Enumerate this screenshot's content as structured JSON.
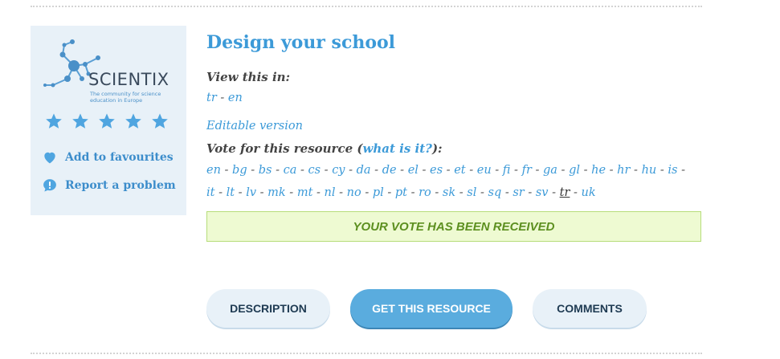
{
  "sidebar": {
    "logo": {
      "word": "SCIENTIX",
      "subtitle": "The community for science education in Europe"
    },
    "rating": {
      "stars": 5,
      "max": 5
    },
    "favourites_label": "Add to favourites",
    "report_label": "Report a problem"
  },
  "resource": {
    "title": "Design your school",
    "view_label": "View this in:",
    "view_languages": [
      "tr",
      "en"
    ],
    "editable_label": "Editable version",
    "vote_label_prefix": "Vote for this resource (",
    "vote_label_link": "what is it?",
    "vote_label_suffix": "):",
    "vote_languages_line1": [
      "en",
      "bg",
      "bs",
      "ca",
      "cs",
      "cy",
      "da",
      "de",
      "el",
      "es",
      "et",
      "eu",
      "fi",
      "fr",
      "ga",
      "gl",
      "he",
      "hr",
      "hu",
      "is"
    ],
    "vote_languages_line2": [
      "it",
      "lt",
      "lv",
      "mk",
      "mt",
      "nl",
      "no",
      "pl",
      "pt",
      "ro",
      "sk",
      "sl",
      "sq",
      "sr",
      "sv",
      "tr",
      "uk"
    ],
    "vote_selected": "tr",
    "vote_notice": "YOUR VOTE HAS BEEN RECEIVED"
  },
  "tabs": {
    "description": "DESCRIPTION",
    "get": "GET THIS RESOURCE",
    "comments": "COMMENTS"
  },
  "colors": {
    "accent": "#3c9ad8",
    "sidebar_bg": "#e8f1f8",
    "notice_bg": "#eefad2",
    "notice_text": "#5c8f1f",
    "primary_button": "#5aacde"
  }
}
